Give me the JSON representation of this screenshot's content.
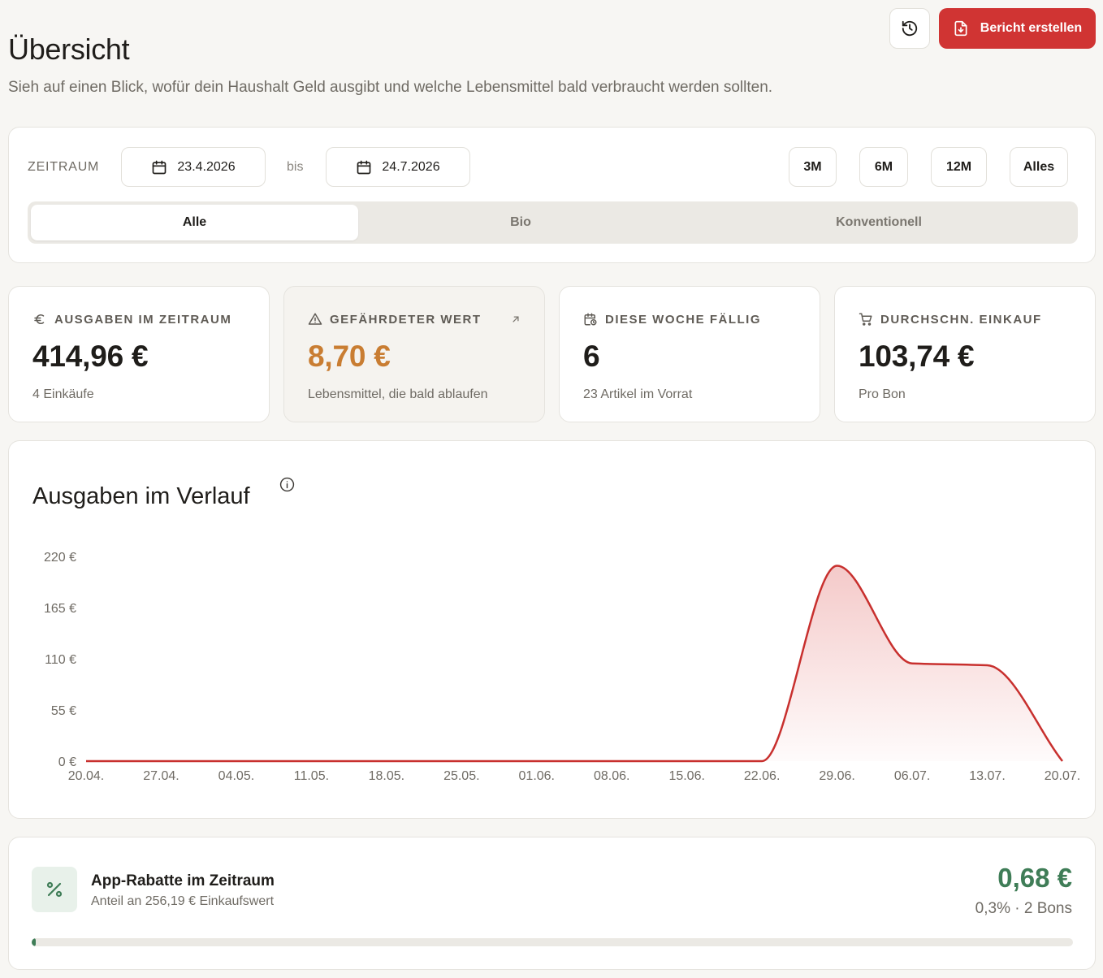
{
  "header": {
    "title": "Übersicht",
    "subtitle": "Sieh auf einen Blick, wofür dein Haushalt Geld ausgibt und welche Lebensmittel bald verbraucht werden sollten.",
    "report_button": "Bericht erstellen",
    "icons": {
      "history": "history-icon",
      "report": "file-download-icon"
    }
  },
  "filter": {
    "label": "ZEITRAUM",
    "from": "23.4.2026",
    "separator": "bis",
    "to": "24.7.2026",
    "ranges": [
      "3M",
      "6M",
      "12M",
      "Alles"
    ],
    "segments": [
      "Alle",
      "Bio",
      "Konventionell"
    ],
    "active_segment": "Alle"
  },
  "kpis": [
    {
      "icon": "euro-icon",
      "label": "AUSGABEN IM ZEITRAUM",
      "value": "414,96 €",
      "sub": "4 Einkäufe"
    },
    {
      "icon": "warning-icon",
      "label": "GEFÄHRDETER WERT",
      "value": "8,70 €",
      "sub": "Lebensmittel, die bald ablaufen",
      "accent": "#c97d32"
    },
    {
      "icon": "calendar-clock-icon",
      "label": "DIESE WOCHE FÄLLIG",
      "value": "6",
      "sub": "23 Artikel im Vorrat"
    },
    {
      "icon": "cart-icon",
      "label": "DURCHSCHN. EINKAUF",
      "value": "103,74 €",
      "sub": "Pro Bon"
    }
  ],
  "chart": {
    "title": "Ausgaben im Verlauf"
  },
  "chart_data": {
    "type": "area",
    "x": [
      "20.04.",
      "27.04.",
      "04.05.",
      "11.05.",
      "18.05.",
      "25.05.",
      "01.06.",
      "08.06.",
      "15.06.",
      "22.06.",
      "29.06.",
      "06.07.",
      "13.07.",
      "20.07."
    ],
    "values": [
      0,
      0,
      0,
      0,
      0,
      0,
      0,
      0,
      0,
      0,
      210,
      105,
      103,
      0
    ],
    "yticks": [
      "0 €",
      "55 €",
      "110 €",
      "165 €",
      "220 €"
    ],
    "ylim": [
      0,
      220
    ],
    "color": "#c8302e",
    "grid": false
  },
  "rebate": {
    "title": "App-Rabatte im Zeitraum",
    "sub": "Anteil an 256,19 € Einkaufswert",
    "value": "0,68 €",
    "meta": "0,3% · 2 Bons",
    "progress_percent": 0.3,
    "accent": "#3f7d57"
  }
}
